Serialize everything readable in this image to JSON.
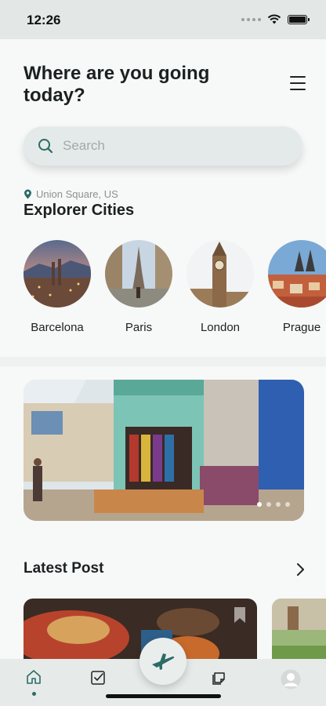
{
  "status_bar": {
    "time": "12:26"
  },
  "header": {
    "title": "Where are you going today?"
  },
  "search": {
    "placeholder": "Search"
  },
  "location": {
    "label": "Union Square, US"
  },
  "explorer": {
    "title": "Explorer Cities",
    "cities": [
      {
        "name": "Barcelona"
      },
      {
        "name": "Paris"
      },
      {
        "name": "London"
      },
      {
        "name": "Prague"
      }
    ]
  },
  "banner": {
    "slides": 4,
    "active_slide": 1
  },
  "latest_post": {
    "title": "Latest Post"
  },
  "colors": {
    "accent": "#2c6b67",
    "background": "#f7f8f8",
    "tabbar": "#e6ebea"
  },
  "icons": [
    "wifi-icon",
    "battery-icon",
    "menu-icon",
    "search-icon",
    "location-pin-icon",
    "chevron-right-icon",
    "bookmark-icon",
    "home-icon",
    "checklist-icon",
    "plane-icon",
    "notes-icon",
    "profile-icon"
  ]
}
